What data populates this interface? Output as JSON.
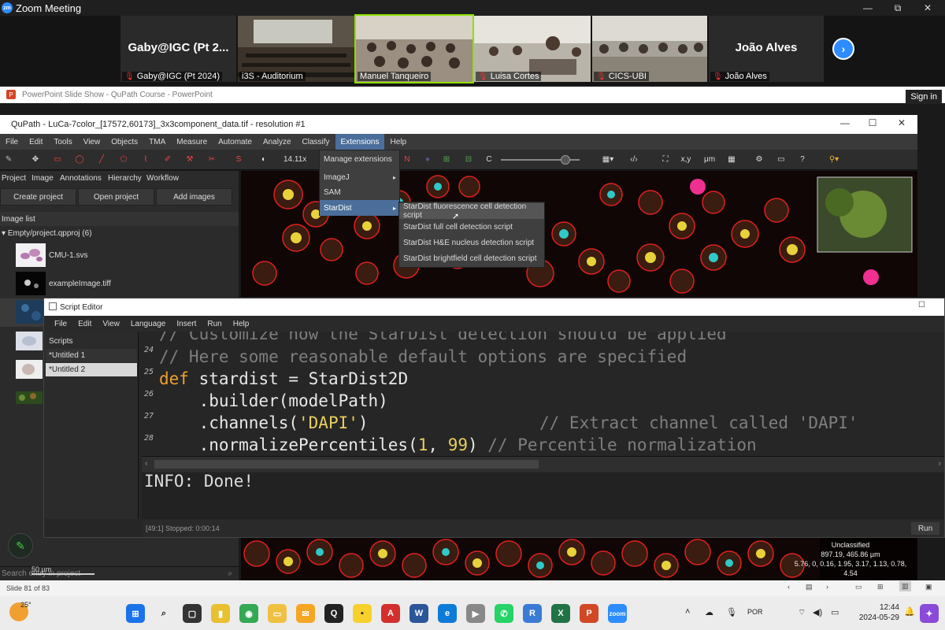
{
  "zoom": {
    "title": "Zoom Meeting",
    "logo": "zm",
    "participants": [
      {
        "name": "Gaby@IGC (Pt 2...",
        "label": "Gaby@IGC (Pt 2024)"
      },
      {
        "label": "i3S - Auditorium"
      },
      {
        "label": "Manuel Tanqueiro"
      },
      {
        "label": "Luisa Cortes"
      },
      {
        "label": "CICS-UBI"
      },
      {
        "name": "João Alves",
        "label": "João Alves"
      }
    ]
  },
  "powerpoint": {
    "title": "PowerPoint Slide Show  -  QuPath Course - PowerPoint",
    "sign_in": "Sign in",
    "slide_info": "Slide 81 of 83"
  },
  "qupath": {
    "title": "QuPath - LuCa-7color_[17572,60173]_3x3component_data.tif - resolution #1",
    "menu": [
      "File",
      "Edit",
      "Tools",
      "View",
      "Objects",
      "TMA",
      "Measure",
      "Automate",
      "Analyze",
      "Classify",
      "Extensions",
      "Help"
    ],
    "zoom_level": "14.11x",
    "tabs": [
      "Project",
      "Image",
      "Annotations",
      "Hierarchy",
      "Workflow"
    ],
    "buttons": [
      "Create project",
      "Open project",
      "Add images"
    ],
    "image_list_label": "Image list",
    "project_node": "Empty/project.qpproj (6)",
    "images": [
      "CMU-1.svs",
      "exampleImage.tiff"
    ],
    "search_placeholder": "Search entry in project",
    "extensions_menu": [
      "Manage extensions",
      "ImageJ",
      "SAM",
      "StarDist"
    ],
    "stardist_menu": [
      "StarDist fluorescence cell detection script",
      "StarDist full cell detection script",
      "StarDist H&E nucleus detection script",
      "StarDist brightfield cell detection script"
    ],
    "overlay": {
      "class": "Unclassified",
      "coords": "897.19, 465.86 µm",
      "values": "5.76, 0, 0.16, 1.95, 3.17, 1.13, 0.78, 4.54"
    },
    "scale_bar": "50 µm"
  },
  "script_editor": {
    "title": "Script Editor",
    "menu": [
      "File",
      "Edit",
      "View",
      "Language",
      "Insert",
      "Run",
      "Help"
    ],
    "scripts_header": "Scripts",
    "scripts": [
      "*Untitled 1",
      "*Untitled 2"
    ],
    "line_numbers": [
      "24",
      "25",
      "26",
      "27",
      "28"
    ],
    "code": {
      "line0": "// Customize how the StarDist detection should be applied",
      "line1": "// Here some reasonable default options are specified",
      "line2_kw": "def",
      "line2_rest": " stardist = StarDist2D",
      "line3": "    .builder(modelPath)",
      "line4_a": "    .channels(",
      "line4_str": "'DAPI'",
      "line4_b": ")",
      "line4_cm": "// Extract channel called 'DAPI'",
      "line5_a": "    .normalizePercentiles(",
      "line5_n1": "1",
      "line5_b": ", ",
      "line5_n2": "99",
      "line5_c": ") ",
      "line5_cm": "// Percentile normalization"
    },
    "console": "INFO: Done!",
    "status": "[49:1]   Stopped: 0:00:14",
    "run_label": "Run"
  },
  "taskbar": {
    "weather": "25°",
    "lang": "POR",
    "time": "12:44",
    "date": "2024-05-29"
  }
}
